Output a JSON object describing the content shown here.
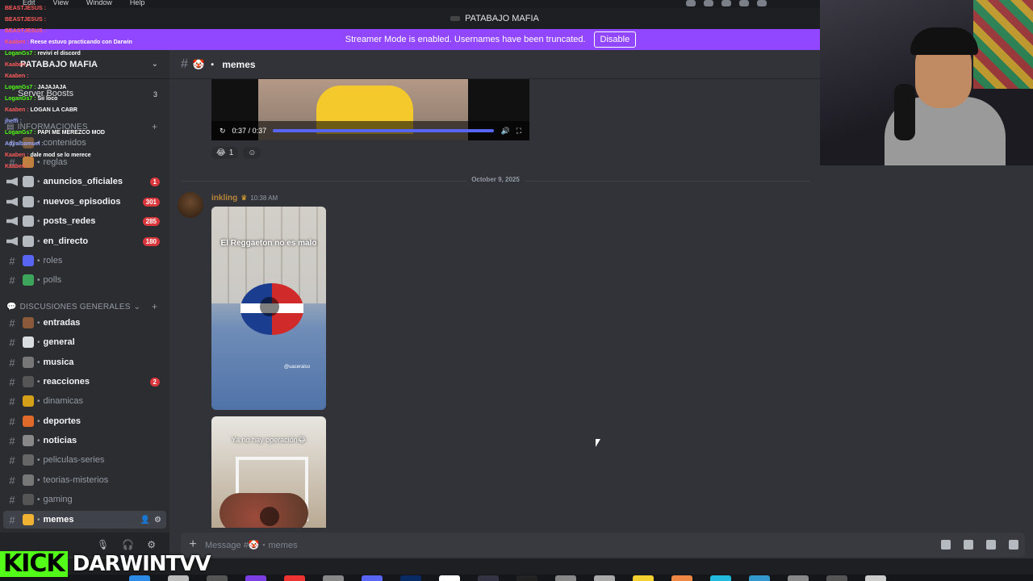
{
  "menubar": {
    "items": [
      "Edit",
      "View",
      "Window",
      "Help"
    ]
  },
  "window_title": "PATABAJO MAFIA",
  "streamer_bar": {
    "message": "Streamer Mode is enabled. Usernames have been truncated.",
    "disable_label": "Disable"
  },
  "server": {
    "name": "PATABAJO MAFIA",
    "boosts_label": "Server Boosts",
    "boosts_count": "3"
  },
  "categories": {
    "informaciones": "INFORMACIONES",
    "discusiones": "DISCUSIONES GENERALES"
  },
  "channels": [
    {
      "name": "contenidos",
      "unread": false,
      "badge": "",
      "type": "text"
    },
    {
      "name": "reglas",
      "unread": false,
      "badge": "",
      "type": "text"
    },
    {
      "name": "anuncios_oficiales",
      "unread": true,
      "badge": "1",
      "type": "announce"
    },
    {
      "name": "nuevos_episodios",
      "unread": true,
      "badge": "301",
      "type": "announce"
    },
    {
      "name": "posts_redes",
      "unread": true,
      "badge": "285",
      "type": "announce"
    },
    {
      "name": "en_directo",
      "unread": true,
      "badge": "180",
      "type": "announce"
    },
    {
      "name": "roles",
      "unread": false,
      "badge": "",
      "type": "text"
    },
    {
      "name": "polls",
      "unread": false,
      "badge": "",
      "type": "text"
    },
    {
      "name": "entradas",
      "unread": true,
      "badge": "",
      "type": "text"
    },
    {
      "name": "general",
      "unread": true,
      "badge": "",
      "type": "text"
    },
    {
      "name": "musica",
      "unread": true,
      "badge": "",
      "type": "text"
    },
    {
      "name": "reacciones",
      "unread": true,
      "badge": "2",
      "type": "text"
    },
    {
      "name": "dinamicas",
      "unread": false,
      "badge": "",
      "type": "text"
    },
    {
      "name": "deportes",
      "unread": true,
      "badge": "",
      "type": "text"
    },
    {
      "name": "noticias",
      "unread": true,
      "badge": "",
      "type": "text"
    },
    {
      "name": "peliculas-series",
      "unread": false,
      "badge": "",
      "type": "text"
    },
    {
      "name": "teorias-misterios",
      "unread": false,
      "badge": "",
      "type": "text"
    },
    {
      "name": "gaming",
      "unread": false,
      "badge": "",
      "type": "text"
    },
    {
      "name": "memes",
      "unread": false,
      "badge": "",
      "type": "text",
      "active": true
    }
  ],
  "chat_overlay": [
    {
      "user": "BEASTJESUS :",
      "text": "",
      "color": "r"
    },
    {
      "user": "BEASTJESUS :",
      "text": "",
      "color": "r"
    },
    {
      "user": "BEASTJESUS :",
      "text": "",
      "color": "r"
    },
    {
      "user": "Kaaben :",
      "text": "Reese estuvo practicando con Darwin",
      "color": "r"
    },
    {
      "user": "LoganGs7 :",
      "text": "reviví el discord",
      "color": "g"
    },
    {
      "user": "Kaaben :",
      "text": "",
      "color": "r"
    },
    {
      "user": "Kaaben :",
      "text": "",
      "color": "r"
    },
    {
      "user": "LoganGs7 :",
      "text": "JAJAJAJA",
      "color": "g"
    },
    {
      "user": "LoganGs7 :",
      "text": "Sii loco",
      "color": "g"
    },
    {
      "user": "Kaaben :",
      "text": "LOGAN LA CABR",
      "color": "r"
    },
    {
      "user": "jheffi :",
      "text": "",
      "color": "b"
    },
    {
      "user": "LoganGs7 :",
      "text": "PAPI ME MEREZCO MOD",
      "color": "g"
    },
    {
      "user": "Adyalbamuel :",
      "text": "",
      "color": "b"
    },
    {
      "user": "Kaaben :",
      "text": "dale mod se lo merece",
      "color": "r"
    },
    {
      "user": "Kaaben :",
      "text": "",
      "color": "r"
    }
  ],
  "channel_header": {
    "name": "memes"
  },
  "video": {
    "time": "0:37 / 0:37"
  },
  "reactions": [
    {
      "emoji": "😂",
      "count": "1"
    }
  ],
  "date_divider": "October 9, 2025",
  "message": {
    "author": "inkling",
    "timestamp": "10:38 AM"
  },
  "image1": {
    "caption": "El Reggaeton no es malo",
    "credit": "@uaceralso"
  },
  "image2": {
    "caption": "Ya no hay operación😂"
  },
  "composer": {
    "placeholder": "Message #🤡・memes"
  },
  "kick": {
    "logo": "KICK",
    "name": "DARWINTVV"
  }
}
